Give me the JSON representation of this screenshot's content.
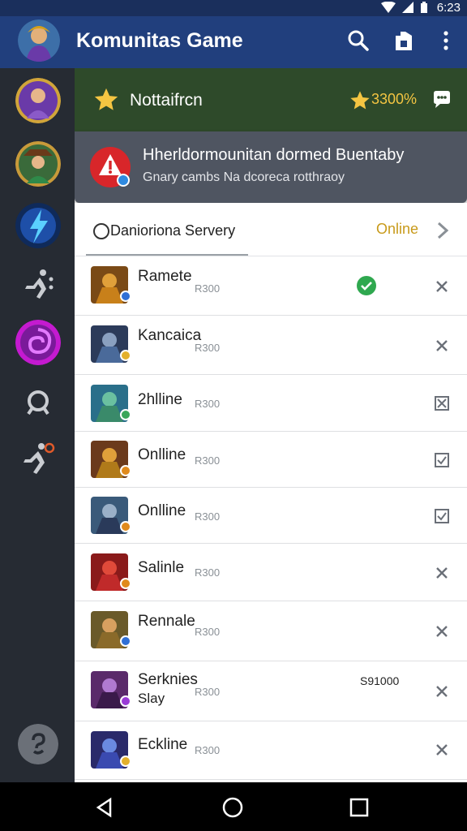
{
  "status_bar": {
    "time": "6:23"
  },
  "app": {
    "title": "Komunitas Game"
  },
  "rail": {
    "items": [
      "hero-avatar",
      "hunter-avatar",
      "lightning-icon",
      "runner-icon",
      "vortex-icon",
      "search-icon",
      "sprint-icon",
      "help-icon"
    ]
  },
  "notification_bar": {
    "label": "Nottaifrcn",
    "points": "3300%"
  },
  "card": {
    "title": "Hherldormounitan dormed Buentaby",
    "subtitle": "Gnary cambs Na dcoreca rotthraoy"
  },
  "server": {
    "name": "Danioriona Servery",
    "status": "Online"
  },
  "players": [
    {
      "name": "Ramete",
      "num": "R300",
      "badge_color": "#2f6fd6",
      "thumb_color": "#7a4a16",
      "action": "check"
    },
    {
      "name": "Kancaica",
      "num": "R300",
      "badge_color": "#e3b02c",
      "thumb_color": "#2c3b5a",
      "action": "close"
    },
    {
      "name": "2hlline",
      "num": "R300",
      "badge_color": "#3aa65a",
      "thumb_color": "#2a6f8a",
      "action": "x-box"
    },
    {
      "name": "Onlline",
      "num": "R300",
      "badge_color": "#e08a1c",
      "thumb_color": "#6b3a1c",
      "action": "checkbox"
    },
    {
      "name": "Onlline",
      "num": "R300",
      "badge_color": "#e08a1c",
      "thumb_color": "#3a5a7a",
      "action": "checkbox"
    },
    {
      "name": "Salinle",
      "num": "R300",
      "badge_color": "#e08a1c",
      "thumb_color": "#8a1a1a",
      "action": "close"
    },
    {
      "name": "Rennale",
      "num": "R300",
      "badge_color": "#2f6fd6",
      "thumb_color": "#6a5a2a",
      "action": "close"
    },
    {
      "name": "Serknies",
      "name2": "Slay",
      "num": "R300",
      "extra": "S91000",
      "badge_color": "#9a3ad6",
      "thumb_color": "#5a2a6a",
      "action": "close"
    },
    {
      "name": "Eckline",
      "num": "R300",
      "badge_color": "#e3b02c",
      "thumb_color": "#2a2a6a",
      "action": "close"
    }
  ],
  "colors": {
    "appbar": "#213f7d",
    "rail": "#262b33",
    "accent": "#f4c542",
    "online": "#c89a1a",
    "check": "#2fa84f"
  }
}
